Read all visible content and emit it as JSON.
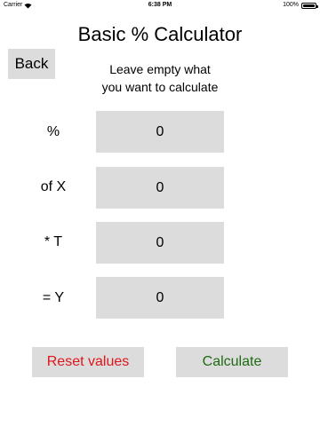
{
  "status_bar": {
    "carrier": "Carrier",
    "time": "6:38 PM",
    "battery": "100%"
  },
  "title": "Basic % Calculator",
  "back_label": "Back",
  "instructions": {
    "line1": "Leave empty what",
    "line2": "you want to calculate"
  },
  "rows": [
    {
      "label": "%",
      "value": "0"
    },
    {
      "label": "of X",
      "value": "0"
    },
    {
      "label": "* T",
      "value": "0"
    },
    {
      "label": "= Y",
      "value": "0"
    }
  ],
  "buttons": {
    "reset_label": "Reset values",
    "calculate_label": "Calculate"
  },
  "colors": {
    "reset": "#e0161b",
    "calculate": "#1f6b13",
    "control_bg": "#dcdcdc"
  }
}
